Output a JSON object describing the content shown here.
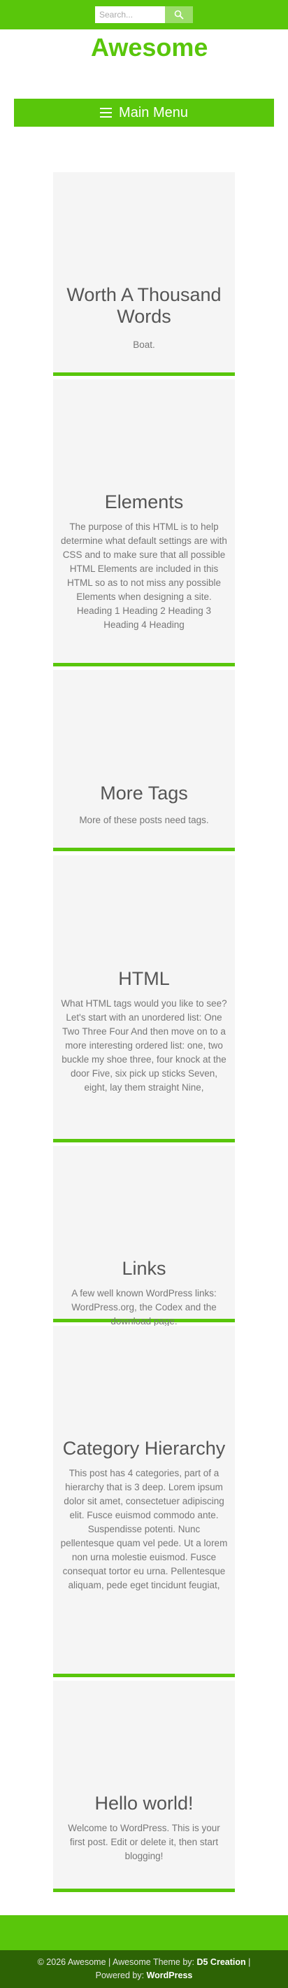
{
  "header": {
    "search": {
      "placeholder": "Search...",
      "value": ""
    },
    "logo_text": "Awesome"
  },
  "menu": {
    "label": "Main Menu"
  },
  "posts": [
    {
      "title": "Worth A Thousand Words",
      "excerpt": "Boat."
    },
    {
      "title": "Elements",
      "excerpt": "The purpose of this HTML is to help determine what default settings are with CSS and to make sure that all possible HTML Elements are included in this HTML so as to not miss any possible Elements when designing a site. Heading 1 Heading 2 Heading 3 Heading 4 Heading"
    },
    {
      "title": "More Tags",
      "excerpt": "More of these posts need tags."
    },
    {
      "title": "HTML",
      "excerpt": "What HTML tags would you like to see? Let's start with an unordered list: One Two Three Four And then move on to a more interesting ordered list: one, two buckle my shoe three, four knock at the door Five, six pick up sticks Seven, eight, lay them straight Nine,"
    },
    {
      "title": "Links",
      "excerpt": "A few well known WordPress links: WordPress.org, the Codex and the download page."
    },
    {
      "title": "Category Hierarchy",
      "excerpt": "This post has 4 categories, part of a hierarchy that is 3 deep. Lorem ipsum dolor sit amet, consectetuer adipiscing elit. Fusce euismod commodo ante. Suspendisse potenti. Nunc pellentesque quam vel pede. Ut a lorem non urna molestie euismod. Fusce consequat tortor eu urna. Pellentesque aliquam, pede eget tincidunt feugiat,"
    },
    {
      "title": "Hello world!",
      "excerpt": "Welcome to WordPress. This is your first post. Edit or delete it, then start blogging!"
    }
  ],
  "footer": {
    "copyright": "© 2026 Awesome | Awesome Theme by:",
    "theme_author": "D5 Creation",
    "separator": "|",
    "powered_by": "Powered by:",
    "platform": "WordPress"
  },
  "colors": {
    "accent": "#59c60b",
    "footer_dark": "#2d6305",
    "card_bg": "#f5f5f5"
  }
}
